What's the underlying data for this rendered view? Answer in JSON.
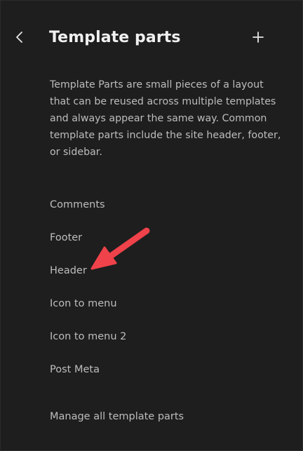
{
  "header": {
    "title": "Template parts"
  },
  "description": "Template Parts are small pieces of a layout that can be reused across multiple templates and always appear the same way. Common template parts include the site header, footer, or sidebar.",
  "template_parts": [
    {
      "label": "Comments"
    },
    {
      "label": "Footer"
    },
    {
      "label": "Header"
    },
    {
      "label": "Icon to menu"
    },
    {
      "label": "Icon to menu 2"
    },
    {
      "label": "Post Meta"
    }
  ],
  "manage_link": "Manage all template parts",
  "icons": {
    "back": "chevron-left-icon",
    "add": "plus-icon"
  },
  "colors": {
    "background": "#1e1e1e",
    "title": "#f0f0f0",
    "text": "#bdbdbd",
    "annotation_arrow": "#f0424a"
  }
}
